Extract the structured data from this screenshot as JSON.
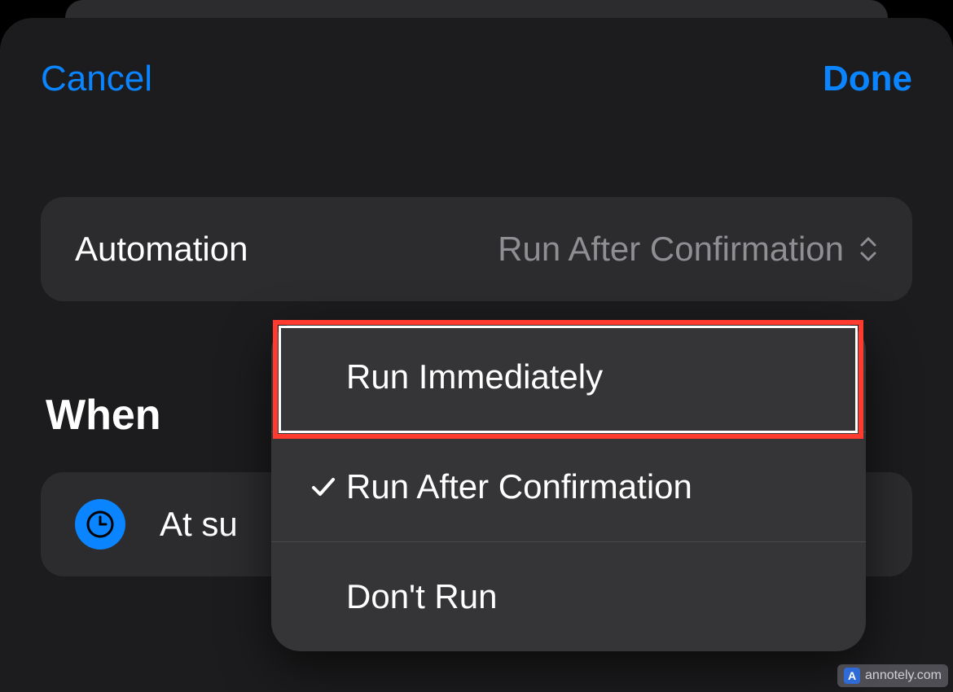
{
  "header": {
    "cancel": "Cancel",
    "done": "Done"
  },
  "automation": {
    "label": "Automation",
    "value": "Run After Confirmation"
  },
  "dropdown": {
    "items": [
      {
        "label": "Run Immediately",
        "checked": false
      },
      {
        "label": "Run After Confirmation",
        "checked": true
      },
      {
        "label": "Don't Run",
        "checked": false
      }
    ],
    "highlighted_index": 0
  },
  "when": {
    "header": "When",
    "trigger_text": "At su"
  },
  "watermark": {
    "text": "annotely.com"
  },
  "colors": {
    "accent": "#0a84ff",
    "highlight": "#ff3b30",
    "bg_sheet": "#1c1c1e",
    "bg_row": "#2c2c2e",
    "bg_popover": "#353537",
    "text_secondary": "#8e8e93"
  }
}
